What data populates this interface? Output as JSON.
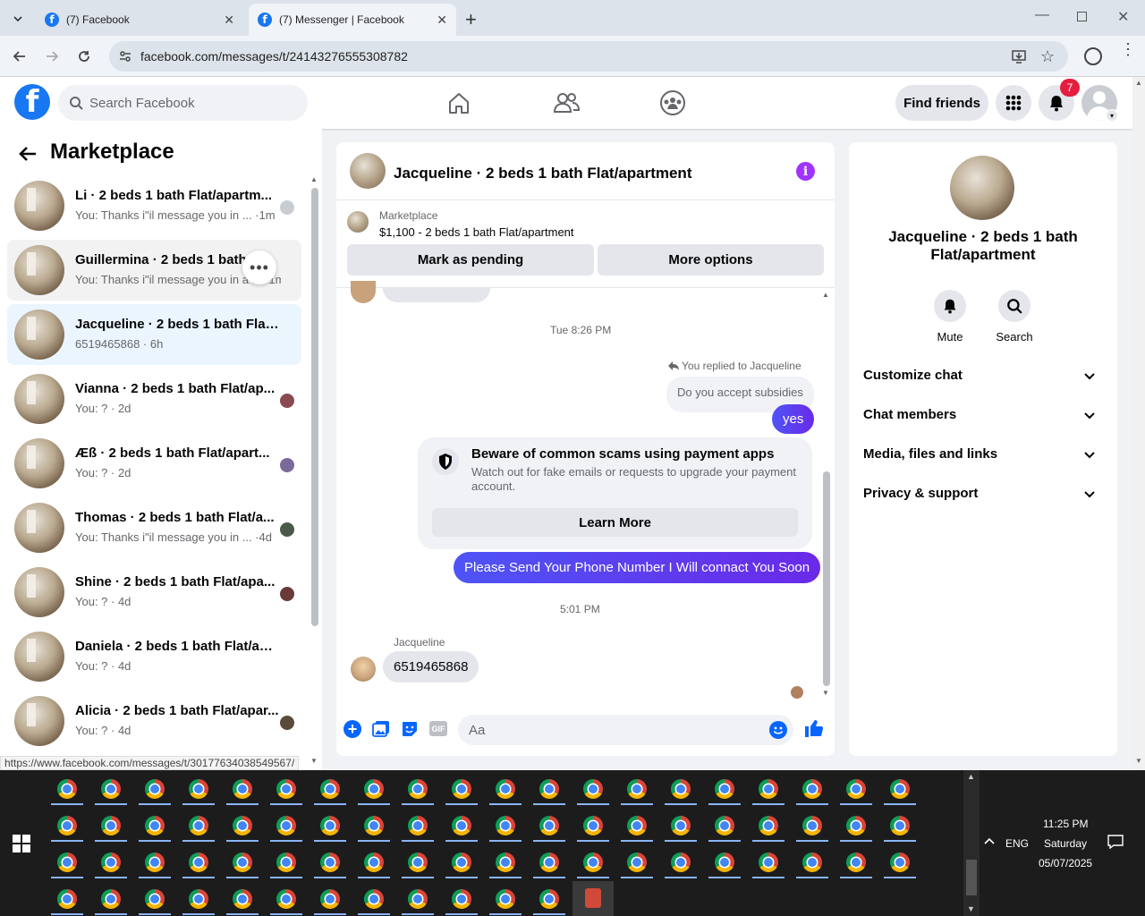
{
  "browser": {
    "tabs": [
      {
        "title": "(7) Facebook"
      },
      {
        "title": "(7) Messenger | Facebook"
      }
    ],
    "url": "facebook.com/messages/t/24143276555308782",
    "status_url": "https://www.facebook.com/messages/t/30177634038549567/"
  },
  "fb_header": {
    "logo": "f",
    "search_placeholder": "Search Facebook",
    "find_friends": "Find friends",
    "notif_count": "7"
  },
  "left_panel": {
    "title": "Marketplace",
    "conversations": [
      {
        "name": "Li · 2 beds 1 bath Flat/apartm...",
        "sub": "You: Thanks i\"il message you in ... ·1m",
        "mini_color": "#c9ccd1",
        "state": "normal"
      },
      {
        "name": "Guillermina · 2 beds 1 bath Fl...",
        "sub": "You: Thanks i\"il message you in a ... ·1m",
        "mini_color": "",
        "state": "hover"
      },
      {
        "name": "Jacqueline · 2 beds 1 bath Flat/a...",
        "sub": "6519465868 · 6h",
        "mini_color": "",
        "state": "selected"
      },
      {
        "name": "Vianna · 2 beds 1 bath Flat/ap...",
        "sub": "You: ? · 2d",
        "mini_color": "#8a4a52",
        "state": "normal"
      },
      {
        "name": "Æß · 2 beds 1 bath Flat/apart...",
        "sub": "You: ? · 2d",
        "mini_color": "#7a6a9a",
        "state": "normal"
      },
      {
        "name": "Thomas · 2 beds 1 bath Flat/a...",
        "sub": "You: Thanks i\"il message you in ... ·4d",
        "mini_color": "#4a5a4a",
        "state": "normal"
      },
      {
        "name": "Shine · 2 beds 1 bath Flat/apa...",
        "sub": "You: ? · 4d",
        "mini_color": "#6a3a3a",
        "state": "normal"
      },
      {
        "name": "Daniela · 2 beds 1 bath Flat/apar...",
        "sub": "You: ? · 4d",
        "mini_color": "",
        "state": "normal"
      },
      {
        "name": "Alicia · 2 beds 1 bath Flat/apar...",
        "sub": "You: ? · 4d",
        "mini_color": "#5a4a3a",
        "state": "normal"
      }
    ]
  },
  "chat": {
    "title": "Jacqueline · 2 beds 1 bath Flat/apartment",
    "marketplace_label": "Marketplace",
    "listing": "$1,100 - 2 beds 1 bath Flat/apartment",
    "mark_pending": "Mark as pending",
    "more_options": "More options",
    "ts1": "Tue 8:26 PM",
    "replied_label": "You replied to Jacqueline",
    "quoted": "Do you accept subsidies",
    "msg_yes": "yes",
    "warn_title": "Beware of common scams using payment apps",
    "warn_body": "Watch out for fake emails or requests to upgrade your payment account.",
    "learn_more": "Learn More",
    "msg_phone_req": "Please Send Your Phone Number I Will connact You Soon",
    "ts2": "5:01 PM",
    "sender": "Jacqueline",
    "msg_number": "6519465868",
    "input_placeholder": "Aa"
  },
  "right_panel": {
    "name": "Jacqueline · 2 beds 1 bath Flat/apartment",
    "mute": "Mute",
    "search": "Search",
    "sections": [
      "Customize chat",
      "Chat members",
      "Media, files and links",
      "Privacy & support"
    ]
  },
  "taskbar": {
    "time": "11:25 PM",
    "day": "Saturday",
    "date": "05/07/2025",
    "lang": "ENG"
  },
  "colors": {
    "fb_blue": "#1877f2",
    "messenger_purple": "#a033ff",
    "out_bubble": "#5b3ef0"
  }
}
